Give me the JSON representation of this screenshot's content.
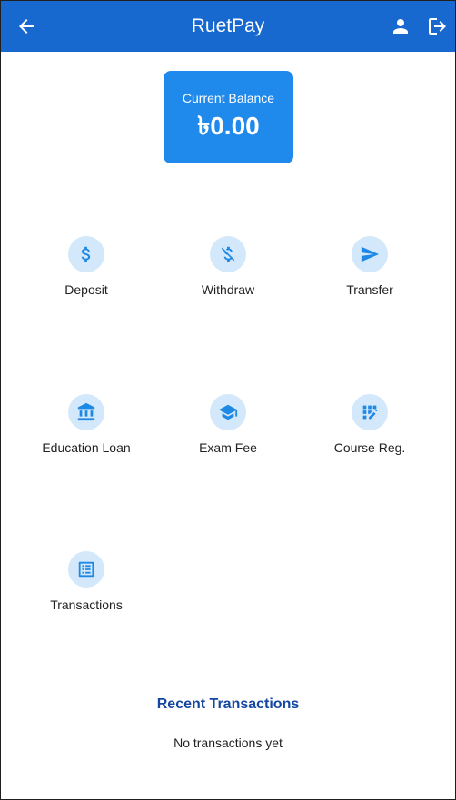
{
  "appbar": {
    "title": "RuetPay",
    "back_icon": "arrow-left-icon",
    "profile_icon": "person-icon",
    "logout_icon": "logout-icon",
    "color": "#1769cf"
  },
  "balance": {
    "label": "Current Balance",
    "amount": "৳0.00",
    "color": "#2089ec"
  },
  "actions": [
    {
      "label": "Deposit",
      "icon": "dollar-icon"
    },
    {
      "label": "Withdraw",
      "icon": "money-off-icon"
    },
    {
      "label": "Transfer",
      "icon": "send-icon"
    },
    {
      "label": "Education Loan",
      "icon": "bank-icon"
    },
    {
      "label": "Exam Fee",
      "icon": "graduation-cap-icon"
    },
    {
      "label": "Course Reg.",
      "icon": "app-registration-icon"
    },
    {
      "label": "Transactions",
      "icon": "list-alt-icon"
    }
  ],
  "recent": {
    "title": "Recent Transactions",
    "empty_text": "No transactions yet",
    "title_color": "#1448a0"
  },
  "colors": {
    "icon": "#1e88e5",
    "icon_bg": "#d3e8fb"
  }
}
